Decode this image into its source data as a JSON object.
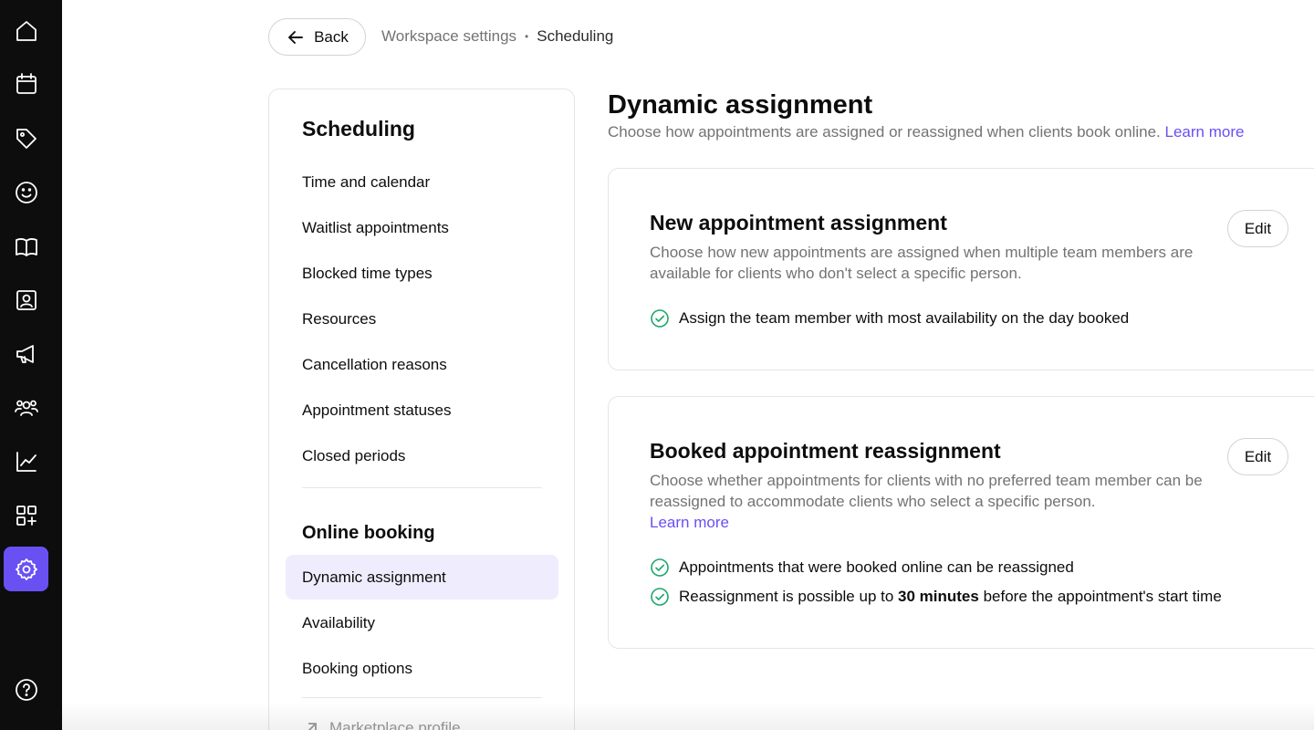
{
  "rail": {
    "items": [
      {
        "name": "home-icon",
        "label": "Home"
      },
      {
        "name": "calendar-icon",
        "label": "Calendar"
      },
      {
        "name": "tag-icon",
        "label": "Sales"
      },
      {
        "name": "smiley-icon",
        "label": "Clients"
      },
      {
        "name": "book-icon",
        "label": "Catalog"
      },
      {
        "name": "contact-card-icon",
        "label": "Team"
      },
      {
        "name": "megaphone-icon",
        "label": "Marketing"
      },
      {
        "name": "people-icon",
        "label": "Team members"
      },
      {
        "name": "chart-line-icon",
        "label": "Reports"
      },
      {
        "name": "apps-add-icon",
        "label": "Add-ons"
      },
      {
        "name": "gear-icon",
        "label": "Settings",
        "active": true
      },
      {
        "name": "help-icon",
        "label": "Help"
      }
    ],
    "accent_color": "#6950f3"
  },
  "topbar": {
    "back_label": "Back",
    "breadcrumb": {
      "parent": "Workspace settings",
      "separator": "•",
      "current": "Scheduling"
    }
  },
  "sidebar": {
    "title": "Scheduling",
    "items": [
      {
        "label": "Time and calendar"
      },
      {
        "label": "Waitlist appointments"
      },
      {
        "label": "Blocked time types"
      },
      {
        "label": "Resources"
      },
      {
        "label": "Cancellation reasons"
      },
      {
        "label": "Appointment statuses"
      },
      {
        "label": "Closed periods"
      }
    ],
    "online_booking": {
      "title": "Online booking",
      "items": [
        {
          "label": "Dynamic assignment",
          "active": true
        },
        {
          "label": "Availability"
        },
        {
          "label": "Booking options"
        }
      ]
    },
    "external": {
      "label": "Marketplace profile",
      "icon": "external-arrow-icon"
    }
  },
  "main": {
    "title": "Dynamic assignment",
    "subtitle": "Choose how appointments are assigned or reassigned when clients book online.",
    "learn_more": "Learn more",
    "cards": [
      {
        "title": "New appointment assignment",
        "description": "Choose how new appointments are assigned when multiple team members are available for clients who don't select a specific person.",
        "edit_label": "Edit",
        "checks": [
          {
            "text": "Assign the team member with most availability on the day booked"
          }
        ]
      },
      {
        "title": "Booked appointment reassignment",
        "description": "Choose whether appointments for clients with no preferred team member can be reassigned to accommodate clients who select a specific person.",
        "learn_more": "Learn more",
        "edit_label": "Edit",
        "checks": [
          {
            "text": "Appointments that were booked online can be reassigned"
          },
          {
            "prefix": "Reassignment is possible up to ",
            "bold": "30 minutes",
            "suffix": " before the appointment's start time"
          }
        ]
      }
    ],
    "check_color": "#1ca86a",
    "link_color": "#6950f3"
  }
}
